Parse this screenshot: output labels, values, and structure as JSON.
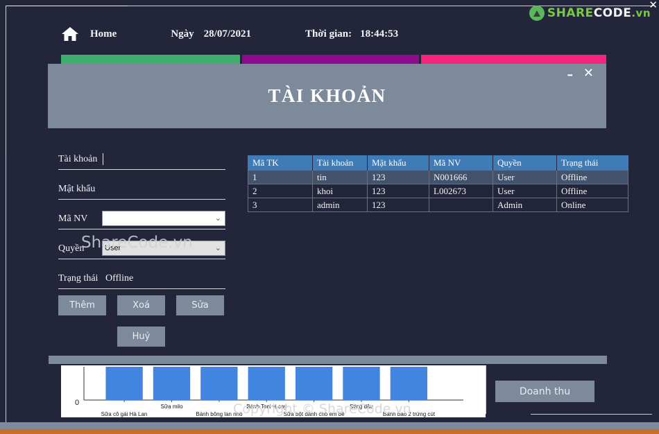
{
  "logo": {
    "share": "SHARE",
    "code": "CODE",
    "vn": ".vn",
    "close": "✕"
  },
  "header": {
    "home_label": "Home",
    "date_label": "Ngày",
    "date_value": "28/07/2021",
    "time_label": "Thời gian:",
    "time_value": "18:44:53"
  },
  "dialog": {
    "title": "TÀI KHOẢN",
    "minimize": "–",
    "close": "✕"
  },
  "form": {
    "fields": [
      {
        "label": "Tài khoản",
        "type": "text",
        "value": "",
        "placeholder": ""
      },
      {
        "label": "Mật khẩu",
        "type": "password",
        "value": "",
        "placeholder": ""
      },
      {
        "label": "Mã NV",
        "type": "select",
        "value": "",
        "arrow": "⌄"
      },
      {
        "label": "Quyền",
        "type": "select",
        "value": "User",
        "arrow": "⌄"
      },
      {
        "label": "Trạng thái",
        "type": "static",
        "value": "Offline"
      }
    ]
  },
  "buttons": {
    "add": "Thêm",
    "delete": "Xoá",
    "edit": "Sửa",
    "cancel": "Huỷ",
    "revenue": "Doanh thu"
  },
  "table": {
    "columns": [
      "Mã TK",
      "Tài khoản",
      "Mật khẩu",
      "Mã NV",
      "Quyền",
      "Trạng thái"
    ],
    "rows": [
      {
        "selected": true,
        "cells": [
          "1",
          "tin",
          "123",
          "N001666",
          "User",
          "Offline"
        ]
      },
      {
        "selected": false,
        "cells": [
          "2",
          "khoi",
          "123",
          "L002673",
          "User",
          "Offline"
        ]
      },
      {
        "selected": false,
        "cells": [
          "3",
          "admin",
          "123",
          "",
          "Admin",
          "Online"
        ]
      }
    ]
  },
  "watermarks": {
    "form": "ShareCode.vn",
    "chart": "Copyright © ShareCode.vn"
  },
  "chart_data": {
    "type": "bar",
    "title": "",
    "xlabel": "",
    "ylabel": "",
    "ytick_labels": [
      "0"
    ],
    "grid": false,
    "legend": false,
    "bar_color": "#4285e0",
    "categories": [
      "Sữa cô gái Hà Lan",
      "Sữa milo",
      "Bánh bông lan nho",
      "Bánh Toni vị cay",
      "Sữa bột dành cho em bé",
      "Sting dâu",
      "Bánh bao 2 trứng cút"
    ],
    "values": [
      1,
      1,
      1,
      1,
      1,
      1,
      1
    ],
    "ylim": [
      0,
      1
    ]
  }
}
